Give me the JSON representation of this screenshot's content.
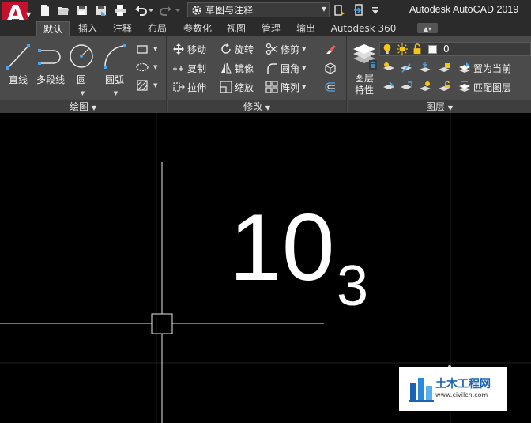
{
  "app": {
    "title": "Autodesk AutoCAD 2019",
    "logo_letter": "A",
    "workspace": "草图与注释"
  },
  "tabs": [
    {
      "label": "默认",
      "active": true
    },
    {
      "label": "插入"
    },
    {
      "label": "注释"
    },
    {
      "label": "布局"
    },
    {
      "label": "参数化"
    },
    {
      "label": "视图"
    },
    {
      "label": "管理"
    },
    {
      "label": "输出"
    },
    {
      "label": "Autodesk 360"
    }
  ],
  "draw_panel": {
    "title": "绘图",
    "tools": {
      "line": "直线",
      "polyline": "多段线",
      "circle": "圆",
      "arc": "圆弧"
    }
  },
  "modify_panel": {
    "title": "修改",
    "tools": {
      "move": "移动",
      "rotate": "旋转",
      "trim": "修剪",
      "copy": "复制",
      "mirror": "镜像",
      "fillet": "圆角",
      "stretch": "拉伸",
      "scale": "缩放",
      "array": "阵列"
    }
  },
  "layers_panel": {
    "title": "图层",
    "properties": "图层\n特性",
    "current_layer": "0",
    "set_current": "置为当前",
    "match_layer": "匹配图层"
  },
  "canvas": {
    "main_text": "10",
    "sub_text": "3"
  },
  "watermark": {
    "name": "土木工程网",
    "url": "www.civilcn.com"
  },
  "colors": {
    "ribbon_bg": "#4b4b4b",
    "titlebar_bg": "#2b2b2b",
    "canvas_bg": "#000000",
    "logo_red": "#c8102e",
    "accent_yellow": "#f5c518",
    "accent_blue": "#4ea5e6"
  }
}
